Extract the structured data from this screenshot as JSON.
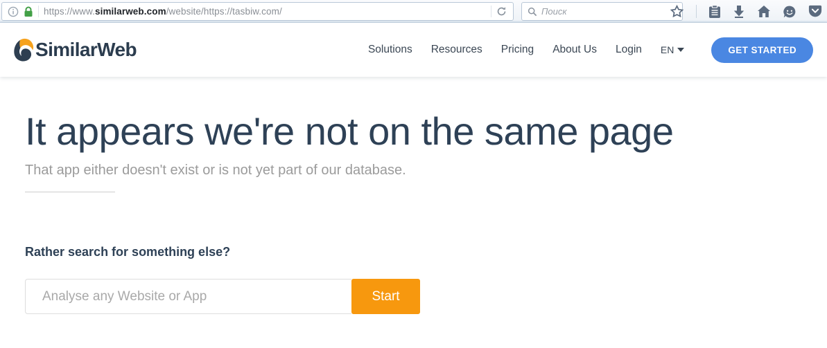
{
  "browser": {
    "url_pre": "https://www.",
    "url_domain": "similarweb.com",
    "url_path": "/website/https://tasbiw.com/",
    "search_placeholder": "Поиск",
    "icons": [
      "info-icon",
      "lock-icon",
      "reload-icon",
      "search-icon",
      "star-icon",
      "clipboard-icon",
      "download-icon",
      "home-icon",
      "chat-smiley-icon",
      "pocket-icon"
    ]
  },
  "header": {
    "logo_text": "SimilarWeb",
    "nav": [
      "Solutions",
      "Resources",
      "Pricing",
      "About Us",
      "Login"
    ],
    "lang": "EN",
    "cta_label": "GET STARTED"
  },
  "main": {
    "title": "It appears we're not on the same page",
    "subtitle": "That app either doesn't exist or is not yet part of our database.",
    "prompt": "Rather search for something else?",
    "input_placeholder": "Analyse any Website or App",
    "start_label": "Start"
  },
  "colors": {
    "accent_orange": "#F7980E",
    "cta_blue": "#4A87E2",
    "brand_navy": "#2E4156",
    "lock_green": "#43A047"
  }
}
